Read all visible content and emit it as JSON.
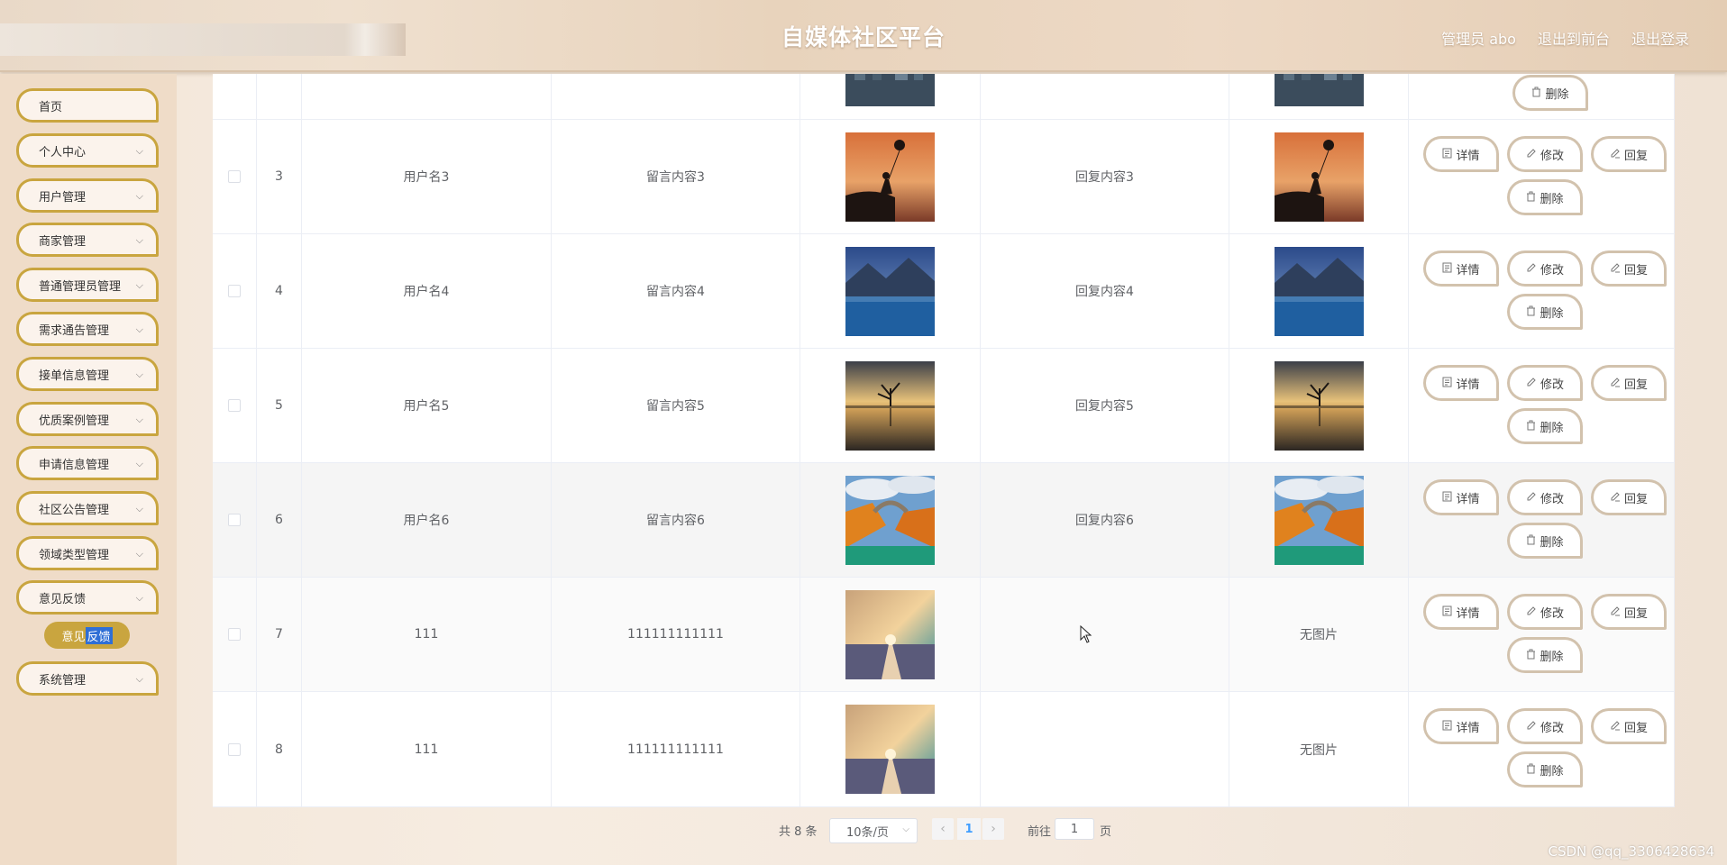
{
  "header": {
    "title": "自媒体社区平台",
    "admin_label": "管理员 abo",
    "front_label": "退出到前台",
    "logout_label": "退出登录"
  },
  "sidebar": {
    "items": [
      {
        "label": "首页",
        "has_children": false
      },
      {
        "label": "个人中心",
        "has_children": true
      },
      {
        "label": "用户管理",
        "has_children": true
      },
      {
        "label": "商家管理",
        "has_children": true
      },
      {
        "label": "普通管理员管理",
        "has_children": true
      },
      {
        "label": "需求通告管理",
        "has_children": true
      },
      {
        "label": "接单信息管理",
        "has_children": true
      },
      {
        "label": "优质案例管理",
        "has_children": true
      },
      {
        "label": "申请信息管理",
        "has_children": true
      },
      {
        "label": "社区公告管理",
        "has_children": true
      },
      {
        "label": "领域类型管理",
        "has_children": true
      },
      {
        "label": "意见反馈",
        "has_children": true
      },
      {
        "label": "系统管理",
        "has_children": true
      }
    ],
    "sub_item": {
      "part1": "意见",
      "part2": "反馈"
    }
  },
  "table": {
    "rows": [
      {
        "index": "",
        "username": "",
        "message": "",
        "message_image": "night-city",
        "reply": "",
        "reply_image": "night-city",
        "reply_no_image_text": "",
        "partial": true
      },
      {
        "index": "3",
        "username": "用户名3",
        "message": "留言内容3",
        "message_image": "balloon-girl-sunset",
        "reply": "回复内容3",
        "reply_image": "balloon-girl-sunset",
        "reply_no_image_text": ""
      },
      {
        "index": "4",
        "username": "用户名4",
        "message": "留言内容4",
        "message_image": "mountain-lake",
        "reply": "回复内容4",
        "reply_image": "mountain-lake",
        "reply_no_image_text": ""
      },
      {
        "index": "5",
        "username": "用户名5",
        "message": "留言内容5",
        "message_image": "lone-tree-reflection",
        "reply": "回复内容5",
        "reply_image": "lone-tree-reflection",
        "reply_no_image_text": ""
      },
      {
        "index": "6",
        "username": "用户名6",
        "message": "留言内容6",
        "message_image": "autumn-bridge",
        "reply": "回复内容6",
        "reply_image": "autumn-bridge",
        "reply_no_image_text": "",
        "hover": true
      },
      {
        "index": "7",
        "username": "111",
        "message": "111111111111",
        "message_image": "sunset-road",
        "reply": "",
        "reply_image": "",
        "reply_no_image_text": "无图片",
        "alt": true
      },
      {
        "index": "8",
        "username": "111",
        "message": "111111111111",
        "message_image": "sunset-road",
        "reply": "",
        "reply_image": "",
        "reply_no_image_text": "无图片"
      }
    ],
    "actions": {
      "detail": "详情",
      "edit": "修改",
      "reply": "回复",
      "delete": "删除"
    }
  },
  "pagination": {
    "total_text": "共 8 条",
    "page_size": "10条/页",
    "current_page": "1",
    "goto_label": "前往",
    "goto_value": "1",
    "page_unit": "页"
  },
  "watermark": "CSDN @qq_3306428634",
  "colors": {
    "accent_gold": "#c9a53f",
    "button_border": "#d2c2ad",
    "active_page": "#409eff",
    "sidebar_bg": "#efdcc8"
  }
}
